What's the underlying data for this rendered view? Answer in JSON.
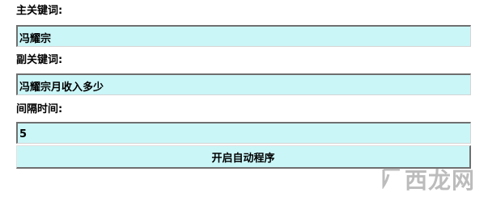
{
  "form": {
    "primary_keyword": {
      "label": "主关键词:",
      "value": "冯耀宗"
    },
    "secondary_keyword": {
      "label": "副关键词:",
      "value": "冯耀宗月收入多少"
    },
    "interval": {
      "label": "间隔时间:",
      "value": "5"
    },
    "start_button": "开启自动程序"
  },
  "watermark": {
    "text": "西龙网"
  },
  "colors": {
    "field_background": "#cbf6f8",
    "field_border_dark": "#6f6f6f",
    "watermark": "#a0a0a0"
  }
}
